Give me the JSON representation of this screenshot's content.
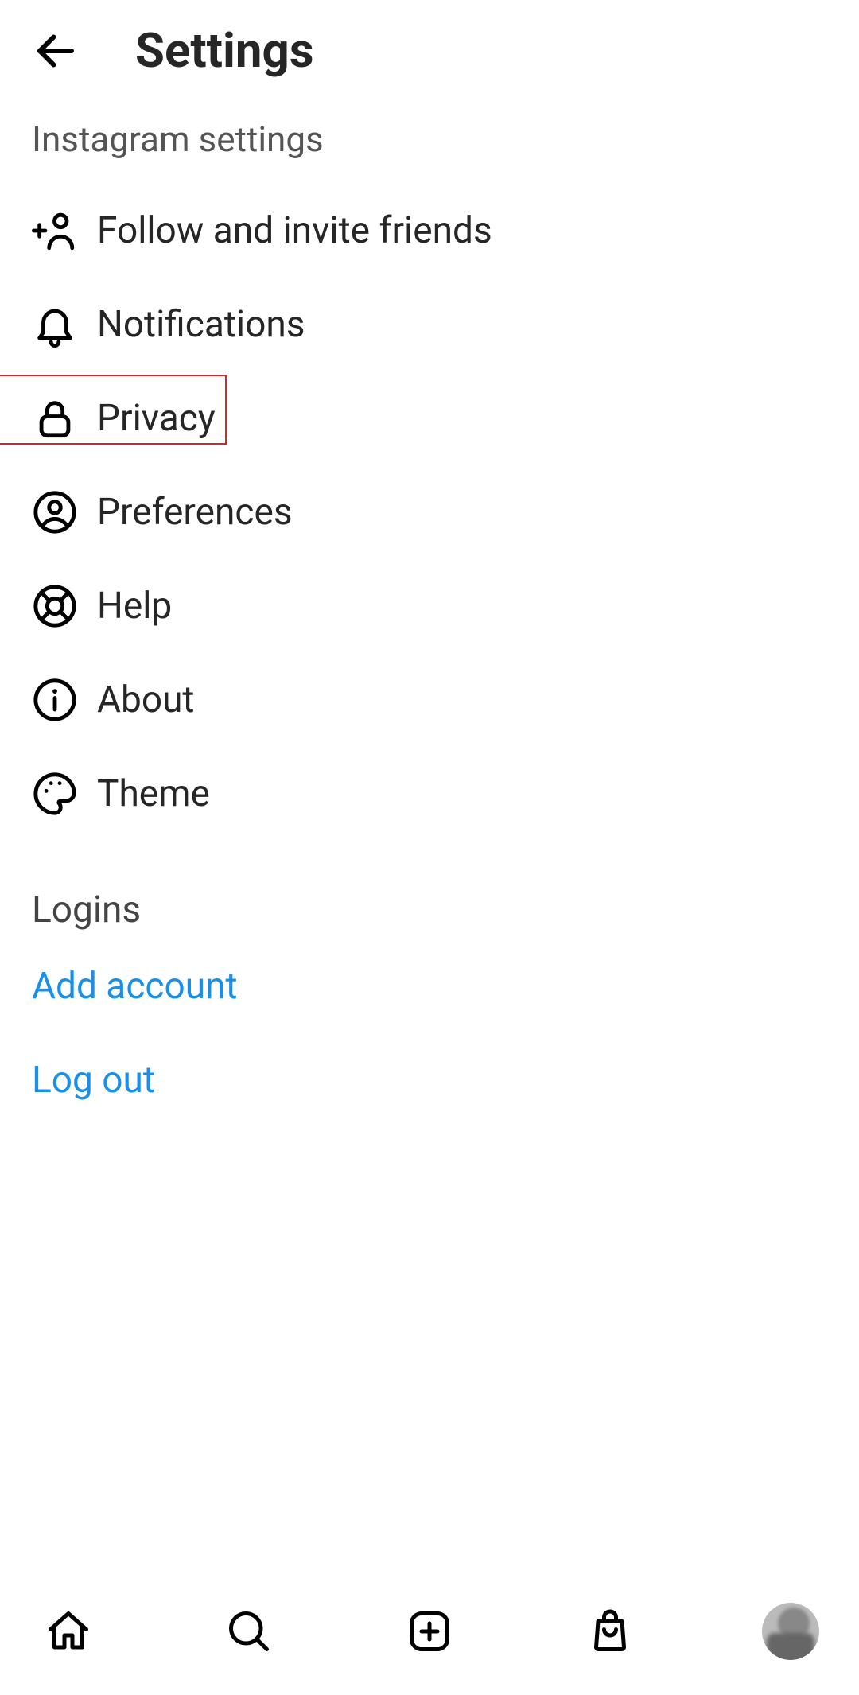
{
  "header": {
    "title": "Settings"
  },
  "subheader": "Instagram settings",
  "items": [
    {
      "label": "Follow and invite friends"
    },
    {
      "label": "Notifications"
    },
    {
      "label": "Privacy"
    },
    {
      "label": "Preferences"
    },
    {
      "label": "Help"
    },
    {
      "label": "About"
    },
    {
      "label": "Theme"
    }
  ],
  "logins": {
    "header": "Logins",
    "add_account": "Add account",
    "logout": "Log out"
  },
  "highlight": {
    "target_index": 2
  },
  "navbar": {
    "home": "home",
    "search": "search",
    "create": "create",
    "shop": "shop",
    "profile": "profile"
  }
}
